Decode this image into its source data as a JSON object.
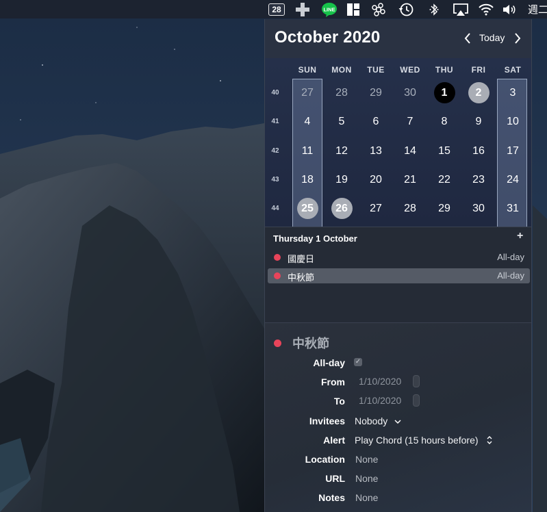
{
  "menubar": {
    "date_badge": "28",
    "clock_text": "週二"
  },
  "calendar": {
    "month_title": "October 2020",
    "nav_today": "Today",
    "weekdays": [
      "SUN",
      "MON",
      "TUE",
      "WED",
      "THU",
      "FRI",
      "SAT"
    ],
    "weeks": [
      {
        "num": "40",
        "days": [
          "27",
          "28",
          "29",
          "30",
          "1",
          "2",
          "3"
        ]
      },
      {
        "num": "41",
        "days": [
          "4",
          "5",
          "6",
          "7",
          "8",
          "9",
          "10"
        ]
      },
      {
        "num": "42",
        "days": [
          "11",
          "12",
          "13",
          "14",
          "15",
          "16",
          "17"
        ]
      },
      {
        "num": "43",
        "days": [
          "18",
          "19",
          "20",
          "21",
          "22",
          "23",
          "24"
        ]
      },
      {
        "num": "44",
        "days": [
          "25",
          "26",
          "27",
          "28",
          "29",
          "30",
          "31"
        ]
      }
    ]
  },
  "events": {
    "date_title": "Thursday 1 October",
    "add_label": "+",
    "items": [
      {
        "name": "國慶日",
        "time": "All-day",
        "color": "#e8445a"
      },
      {
        "name": "中秋節",
        "time": "All-day",
        "color": "#e8445a"
      }
    ]
  },
  "detail": {
    "title": "中秋節",
    "color": "#e8445a",
    "allday_label": "All-day",
    "from_label": "From",
    "from_value": "1/10/2020",
    "to_label": "To",
    "to_value": "1/10/2020",
    "invitees_label": "Invitees",
    "invitees_value": "Nobody",
    "alert_label": "Alert",
    "alert_value": "Play Chord (15 hours before)",
    "location_label": "Location",
    "location_value": "None",
    "url_label": "URL",
    "url_value": "None",
    "notes_label": "Notes",
    "notes_value": "None"
  }
}
